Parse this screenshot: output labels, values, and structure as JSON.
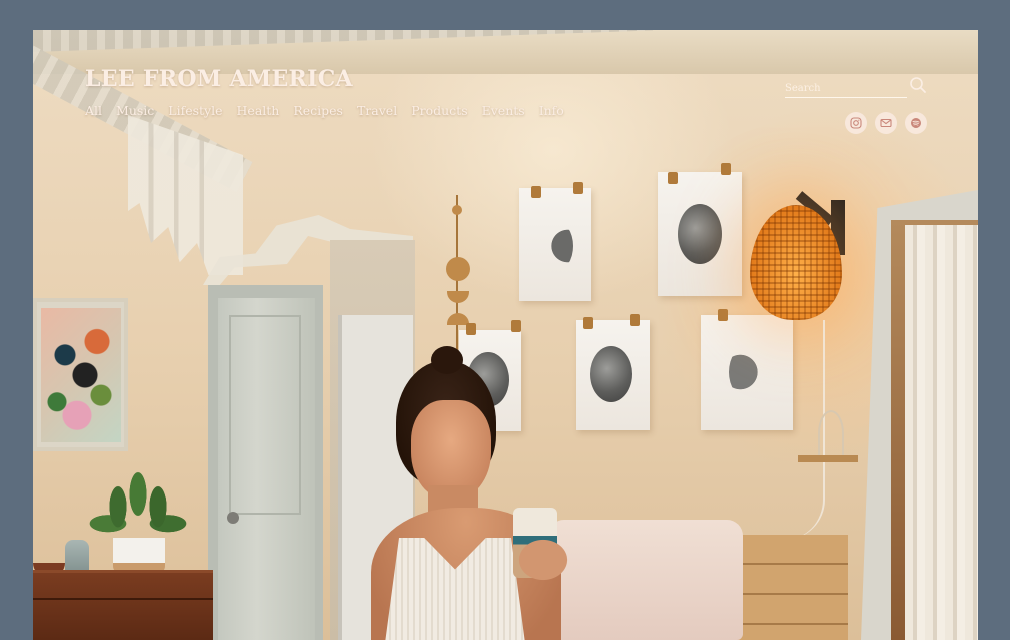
{
  "site": {
    "title": "LEE FROM AMERICA"
  },
  "nav": {
    "items": [
      {
        "label": "All"
      },
      {
        "label": "Music"
      },
      {
        "label": "Lifestyle"
      },
      {
        "label": "Health"
      },
      {
        "label": "Recipes"
      },
      {
        "label": "Travel"
      },
      {
        "label": "Products"
      },
      {
        "label": "Events"
      },
      {
        "label": "Info"
      }
    ]
  },
  "search": {
    "placeholder": "Search",
    "value": "",
    "icon": "search-icon"
  },
  "social": {
    "icons": [
      "instagram-icon",
      "email-icon",
      "spotify-icon"
    ]
  },
  "colors": {
    "page_background": "#5d6d7e",
    "header_text": "#fbeee4",
    "social_button": "#f8e8dc",
    "social_icon": "#c9877a"
  }
}
